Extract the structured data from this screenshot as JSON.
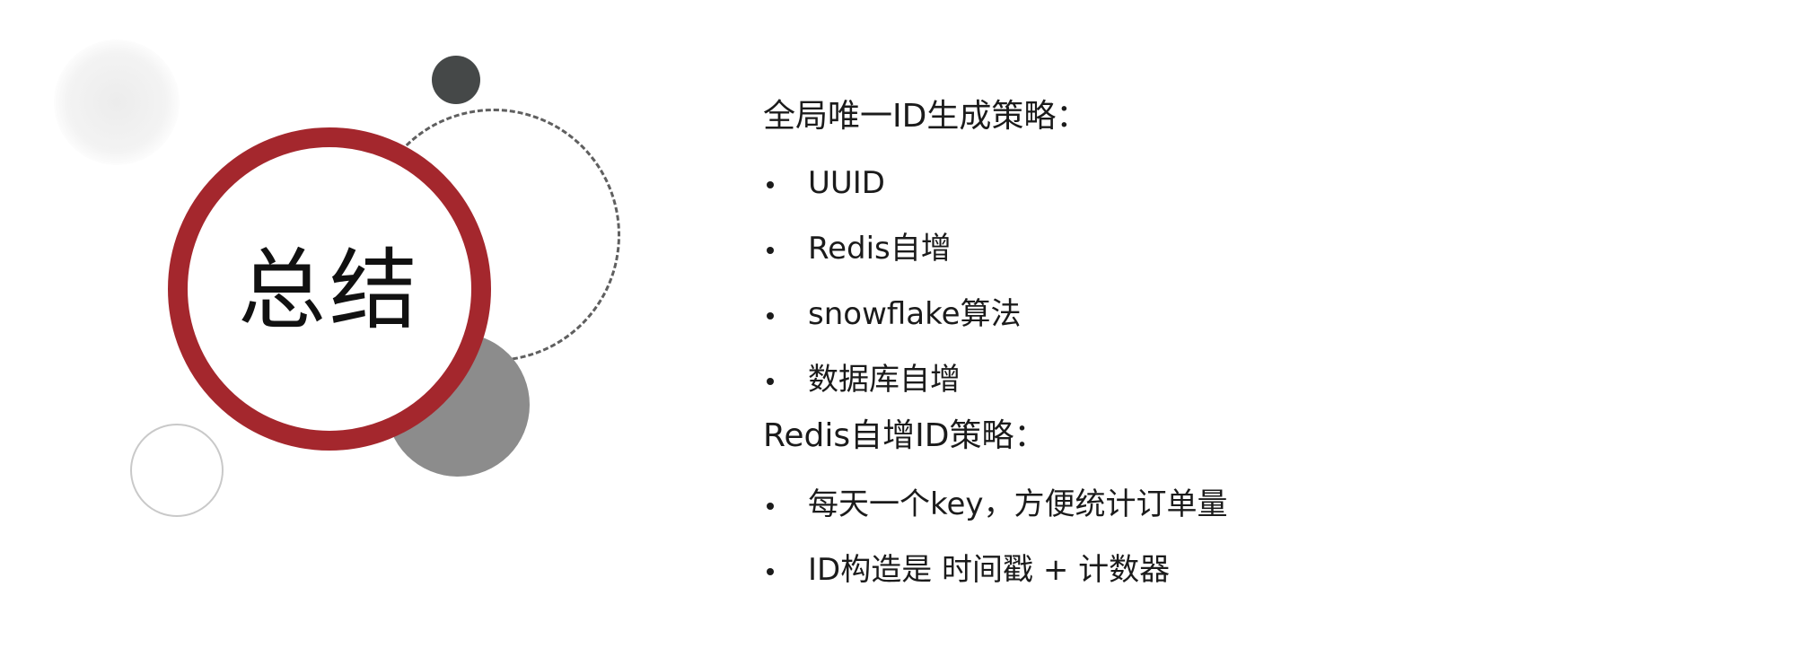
{
  "slide": {
    "title": "总结",
    "accent_color": "#a4272d",
    "sections": [
      {
        "heading": "全局唯一ID生成策略：",
        "items": [
          "UUID",
          "Redis自增",
          "snowflake算法",
          "数据库自增"
        ]
      },
      {
        "heading": "Redis自增ID策略：",
        "items": [
          "每天一个key，方便统计订单量",
          "ID构造是 时间戳 + 计数器"
        ]
      }
    ]
  }
}
